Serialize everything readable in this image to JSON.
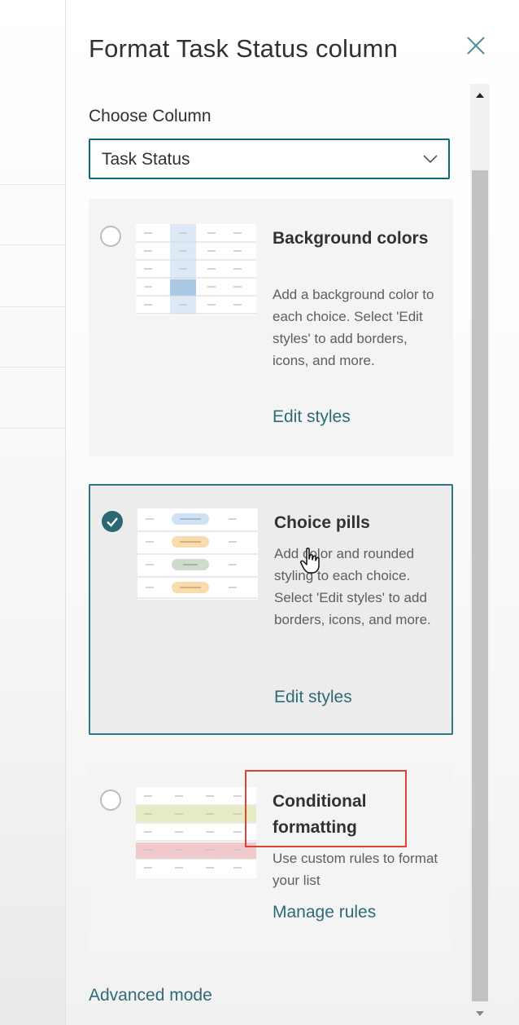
{
  "panel": {
    "title": "Format Task Status column",
    "close_icon": "close-icon"
  },
  "choose_column": {
    "label": "Choose Column",
    "selected_value": "Task Status"
  },
  "cards": [
    {
      "title": "Background colors",
      "description": "Add a background color to each choice. Select 'Edit styles' to add borders, icons, and more.",
      "link": "Edit styles",
      "selected": false
    },
    {
      "title": "Choice pills",
      "description": "Add color and rounded styling to each choice. Select 'Edit styles' to add borders, icons, and more.",
      "link": "Edit styles",
      "selected": true
    },
    {
      "title": "Conditional formatting",
      "description": "Use custom rules to format your list",
      "link": "Manage rules",
      "selected": false
    }
  ],
  "advanced_mode": "Advanced mode",
  "colors": {
    "accent": "#2e6b77",
    "selected_border": "#2e7785",
    "highlight_box": "#e0432f"
  }
}
